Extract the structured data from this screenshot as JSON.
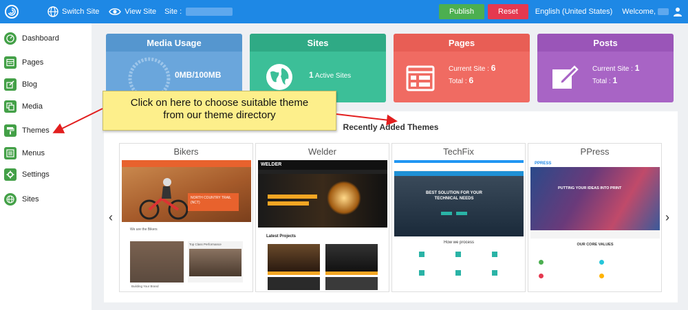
{
  "topbar": {
    "switch_site": "Switch Site",
    "view_site": "View Site",
    "site_label": "Site :",
    "publish": "Publish",
    "reset": "Reset",
    "language": "English (United States)",
    "welcome": "Welcome,"
  },
  "sidebar": {
    "items": [
      {
        "label": "Dashboard",
        "icon": "dashboard-icon"
      },
      {
        "label": "Pages",
        "icon": "pages-icon"
      },
      {
        "label": "Blog",
        "icon": "blog-icon"
      },
      {
        "label": "Media",
        "icon": "media-icon"
      },
      {
        "label": "Themes",
        "icon": "paint-roller-icon"
      },
      {
        "label": "Menus",
        "icon": "menus-icon"
      },
      {
        "label": "Settings",
        "icon": "gear-icon"
      },
      {
        "label": "Sites",
        "icon": "globe-icon"
      }
    ]
  },
  "cards": {
    "media": {
      "title": "Media Usage",
      "value": "0MB/100MB"
    },
    "sites": {
      "title": "Sites",
      "count": "1",
      "suffix": "Active Sites"
    },
    "pages": {
      "title": "Pages",
      "current_label": "Current Site :",
      "current_value": "6",
      "total_label": "Total :",
      "total_value": "6"
    },
    "posts": {
      "title": "Posts",
      "current_label": "Current Site :",
      "current_value": "1",
      "total_label": "Total :",
      "total_value": "1"
    }
  },
  "callout": {
    "line1": "Click on here to choose suitable theme",
    "line2": "from our theme directory"
  },
  "themes": {
    "title": "Recently Added Themes",
    "prev": "‹",
    "next": "›",
    "items": [
      {
        "name": "Bikers",
        "hero_text": "NORTH COUNTRY TRAIL (NCT)",
        "section": "We are the Bikers",
        "sub": "Top Class Performance",
        "foot": "Building Your Brand"
      },
      {
        "name": "Welder",
        "brand": "WELDER",
        "section": "Latest Projects"
      },
      {
        "name": "TechFix",
        "hero_line1": "BEST SOLUTION FOR YOUR",
        "hero_line2": "TECHNICAL NEEDS",
        "section": "How we process"
      },
      {
        "name": "PPress",
        "brand": "PPRESS",
        "hero_text": "PUTTING YOUR IDEAS INTO PRINT",
        "section": "OUR CORE VALUES"
      }
    ]
  },
  "colors": {
    "topbar": "#1e88e5",
    "sidebar_icon": "#43a047",
    "publish": "#4caf50",
    "reset": "#e53950"
  }
}
